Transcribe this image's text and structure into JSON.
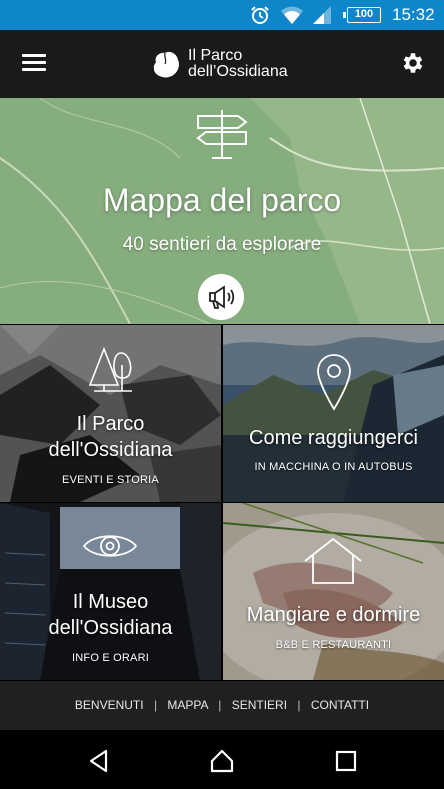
{
  "status_bar": {
    "battery": "100",
    "time": "15:32",
    "icons": [
      "alarm-clock-icon",
      "wifi-icon",
      "signal-icon",
      "battery-icon"
    ],
    "color": "#0e86c9"
  },
  "app_bar": {
    "logo_line1": "Il Parco",
    "logo_line2": "dell’Ossidiana",
    "menu_icon": "hamburger-menu-icon",
    "settings_icon": "gear-icon",
    "background": "#1a1a1a"
  },
  "hero": {
    "title": "Mappa del parco",
    "subtitle": "40 sentieri da esplorare",
    "icon": "signpost-icon",
    "audio_icon": "megaphone-icon",
    "map_color": "#86ad7e"
  },
  "tiles": [
    {
      "title_line1": "Il Parco",
      "title_line2": "dell'Ossidiana",
      "subtitle": "EVENTI E STORIA",
      "icon": "trees-icon"
    },
    {
      "title_line1": "Come raggiungerci",
      "subtitle": "IN MACCHINA O IN AUTOBUS",
      "icon": "map-pin-icon"
    },
    {
      "title_line1": "Il Museo",
      "title_line2": "dell'Ossidiana",
      "subtitle": "INFO E ORARI",
      "icon": "eye-icon"
    },
    {
      "title_line1": "Mangiare e dormire",
      "subtitle": "B&B E RESTAURANTI",
      "icon": "house-icon"
    }
  ],
  "footer": {
    "links": [
      "BENVENUTI",
      "MAPPA",
      "SENTIERI",
      "CONTATTI"
    ],
    "separator": "|"
  },
  "nav_bar": {
    "icons": [
      "back-triangle-icon",
      "home-circle-icon",
      "recents-square-icon"
    ]
  }
}
